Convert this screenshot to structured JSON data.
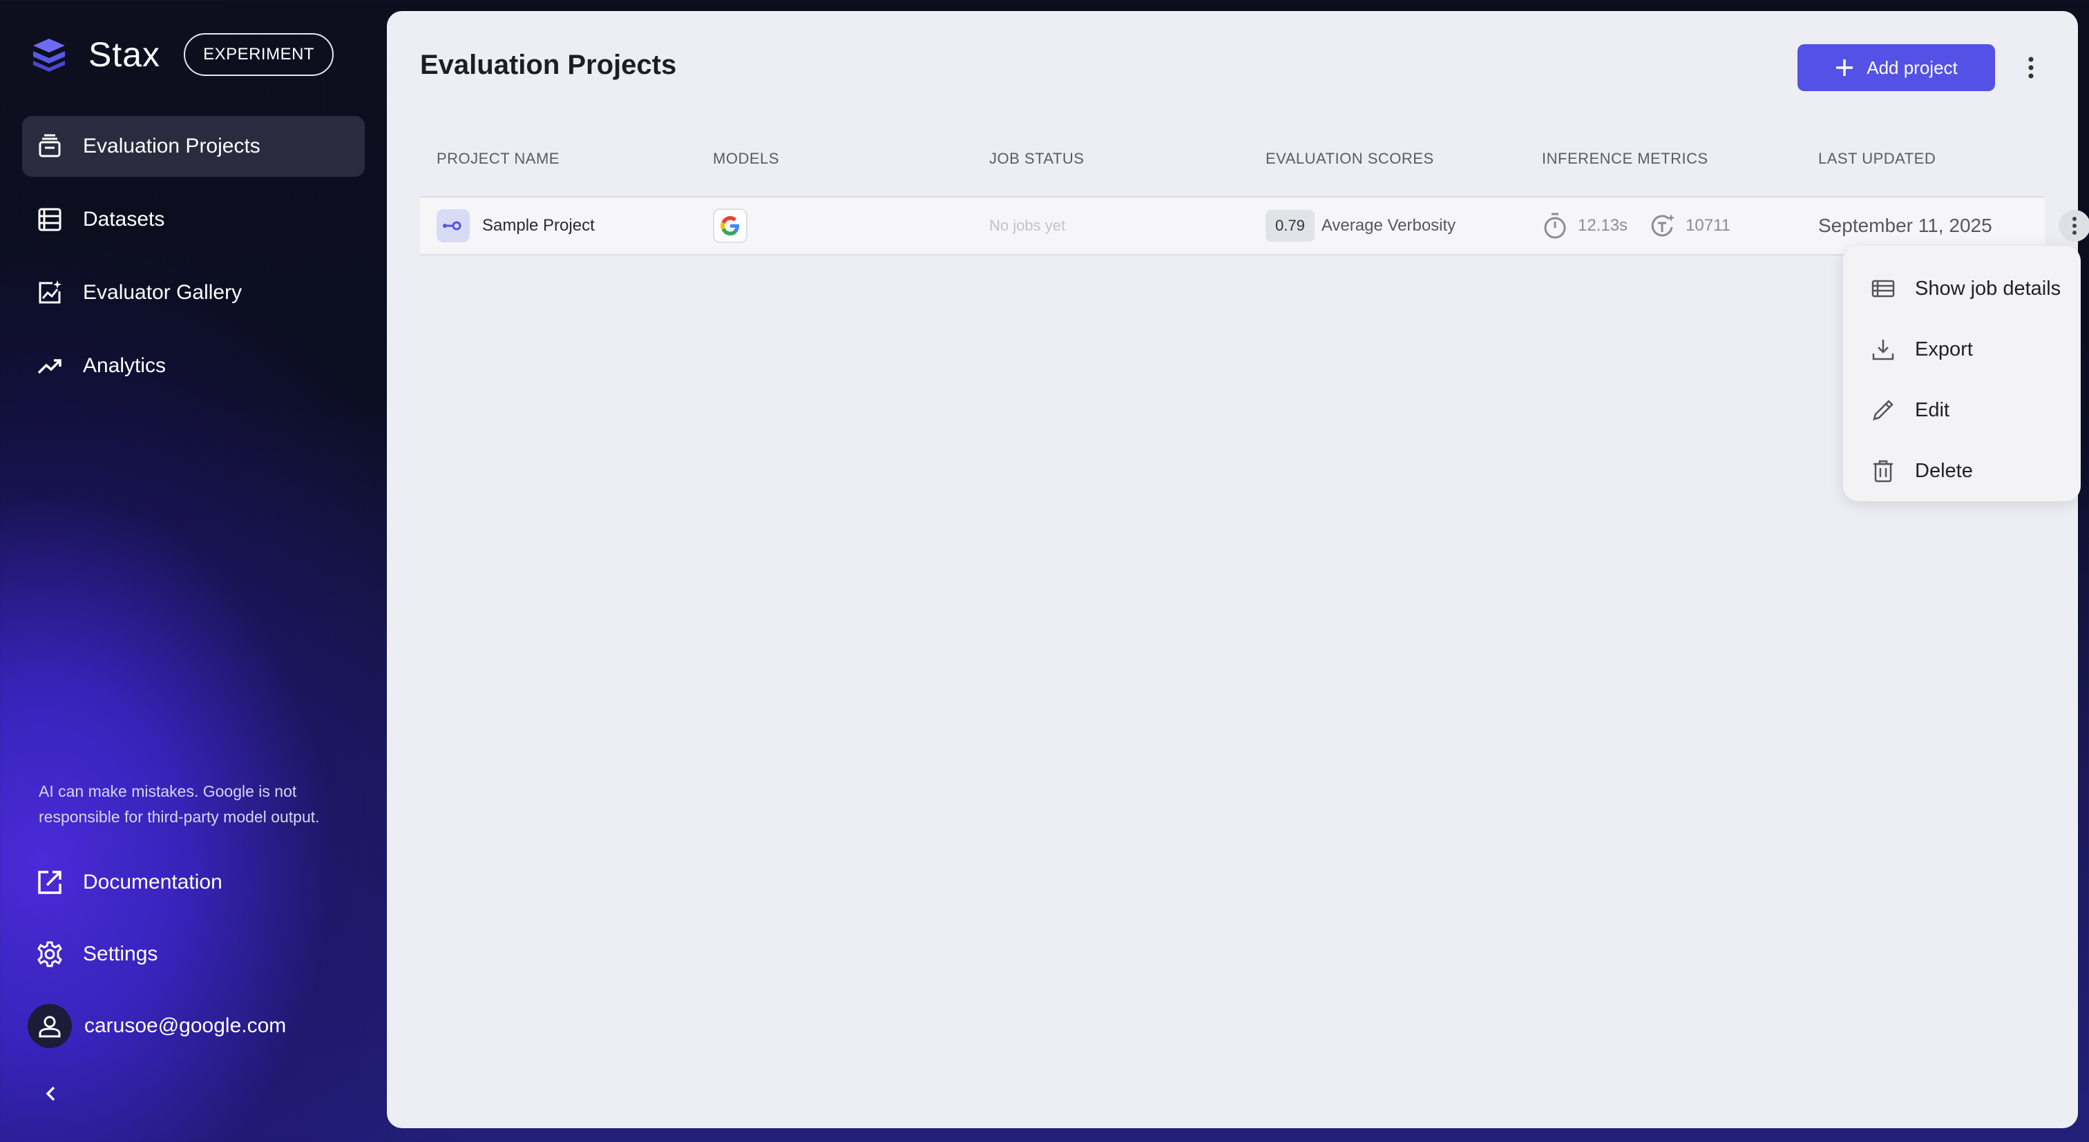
{
  "brand": {
    "name": "Stax",
    "badge": "EXPERIMENT"
  },
  "sidebar": {
    "items": [
      {
        "label": "Evaluation Projects",
        "icon": "projects-icon",
        "active": true
      },
      {
        "label": "Datasets",
        "icon": "datasets-icon"
      },
      {
        "label": "Evaluator Gallery",
        "icon": "gallery-icon"
      },
      {
        "label": "Analytics",
        "icon": "analytics-icon"
      }
    ],
    "disclaimer": "AI can make mistakes. Google is not responsible for third-party model output.",
    "bottom": [
      {
        "label": "Documentation",
        "icon": "external-link-icon"
      },
      {
        "label": "Settings",
        "icon": "gear-icon"
      }
    ],
    "user": {
      "email": "carusoe@google.com",
      "icon": "person-icon"
    }
  },
  "main": {
    "title": "Evaluation Projects",
    "add_button": "Add project",
    "columns": [
      "PROJECT NAME",
      "MODELS",
      "JOB STATUS",
      "EVALUATION SCORES",
      "INFERENCE METRICS",
      "LAST UPDATED"
    ],
    "rows": [
      {
        "name": "Sample Project",
        "model_icon": "google-g-icon",
        "job_status": "No jobs yet",
        "score": "0.79",
        "score_label": "Average Verbosity",
        "latency": "12.13s",
        "tokens": "10711",
        "updated": "September 11, 2025"
      }
    ]
  },
  "menu": {
    "items": [
      {
        "label": "Show job details",
        "icon": "table-icon"
      },
      {
        "label": "Export",
        "icon": "download-icon"
      },
      {
        "label": "Edit",
        "icon": "pencil-icon"
      },
      {
        "label": "Delete",
        "icon": "trash-icon"
      }
    ]
  },
  "colors": {
    "accent": "#5452e6",
    "sidebar_bg": "#0d0f1e",
    "panel_bg": "#edeef3"
  }
}
